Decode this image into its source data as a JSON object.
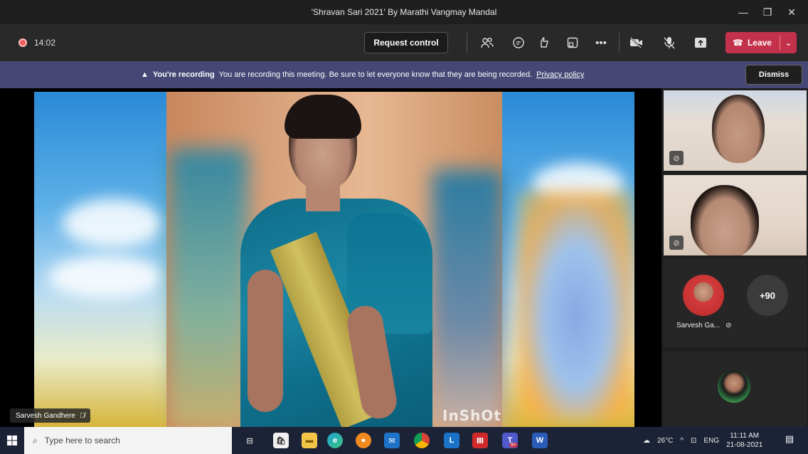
{
  "window": {
    "title": "'Shravan Sari 2021' By Marathi Vangmay Mandal",
    "controls": [
      "—",
      "❐",
      "✕"
    ]
  },
  "toolbar": {
    "timer": "14:02",
    "request_control": "Request control",
    "leave": "Leave",
    "icons": [
      "participants-icon",
      "chat-icon",
      "reactions-icon",
      "rooms-icon",
      "more-icon",
      "camera-off-icon",
      "mic-off-icon",
      "share-icon"
    ]
  },
  "banner": {
    "title": "You're recording",
    "message": "You are recording this meeting. Be sure to let everyone know that they are being recorded.",
    "link": "Privacy policy",
    "dismiss": "Dismiss"
  },
  "stage": {
    "speaker_name": "Sarvesh Gandhere",
    "watermark": "InShOt"
  },
  "participants": {
    "sg_name": "Sarvesh Ga...",
    "overflow": "+90"
  },
  "taskbar": {
    "search_placeholder": "Type here to search",
    "weather": "26°C",
    "lang": "ENG",
    "time": "11:11 AM",
    "date": "21-08-2021",
    "apps": [
      {
        "glyph": "L",
        "color": "#1a73c8"
      },
      {
        "glyph": "Ⅲ",
        "color": "#d12a2a"
      },
      {
        "glyph": "T",
        "color": "#5059c9"
      },
      {
        "glyph": "W",
        "color": "#2b5cb8"
      }
    ],
    "teams_badge": "9+"
  }
}
